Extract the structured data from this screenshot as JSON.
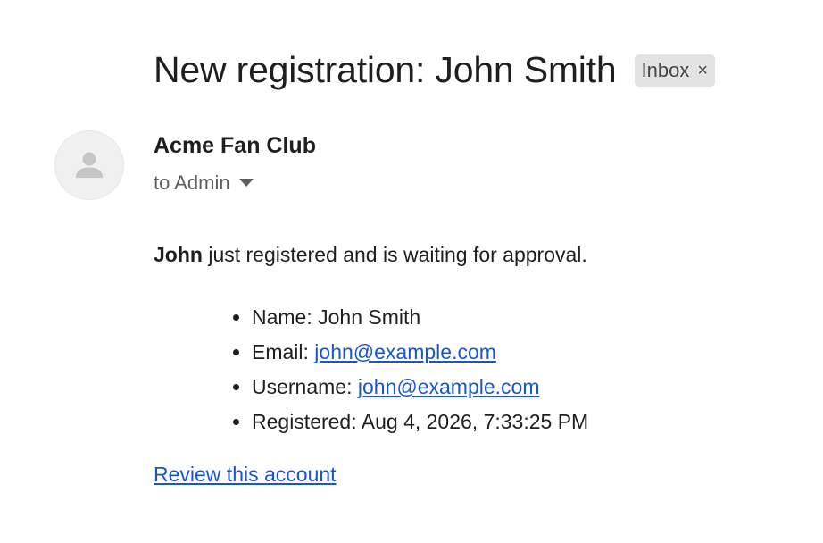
{
  "email": {
    "subject": "New registration: John Smith",
    "label": "Inbox",
    "label_close_glyph": "×",
    "sender": "Acme Fan Club",
    "recipient": "to Admin",
    "body": {
      "intro_name": "John",
      "intro_rest": " just registered and is waiting for approval.",
      "details": [
        {
          "label": "Name: ",
          "value": "John Smith"
        },
        {
          "label": "Email: ",
          "value": "john@example.com"
        },
        {
          "label": "Username: ",
          "value": "john@example.com"
        },
        {
          "label": "Registered: ",
          "value": "Aug 4, 2026, 7:33:25 PM"
        }
      ],
      "review_link": "Review this account"
    }
  },
  "icons": {
    "avatar": "person-icon",
    "dropdown": "caret-down-icon",
    "chip_close": "close-icon"
  },
  "colors": {
    "link": "#1a55c9",
    "chip_bg": "#e3e3e3",
    "avatar_bg": "#f0f0f0",
    "avatar_glyph": "#c4c7c5"
  }
}
